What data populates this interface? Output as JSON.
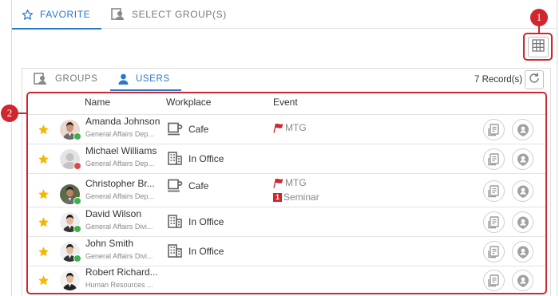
{
  "tabs": {
    "favorite": "FAVORITE",
    "select_groups": "SELECT GROUP(S)"
  },
  "sub_tabs": {
    "groups": "GROUPS",
    "users": "USERS"
  },
  "record_count": "7 Record(s)",
  "callouts": {
    "one": "1",
    "two": "2"
  },
  "columns": {
    "name": "Name",
    "workplace": "Workplace",
    "event": "Event"
  },
  "colors": {
    "accent": "#2b78c5",
    "callout": "#d0262d",
    "star": "#f5b800",
    "online": "#3cb34a",
    "busy": "#e04848"
  },
  "users": [
    {
      "name": "Amanda Johnson",
      "dept": "General Affairs Dep...",
      "status": "online",
      "workplace": "Cafe",
      "workplace_icon": "coffee-cup-icon",
      "events": [
        {
          "icon": "red-flag-icon",
          "label": "MTG"
        }
      ]
    },
    {
      "name": "Michael Williams",
      "dept": "General Affairs Dep...",
      "status": "busy",
      "workplace": "In Office",
      "workplace_icon": "office-building-icon",
      "events": []
    },
    {
      "name": "Christopher Br...",
      "dept": "General Affairs Dep...",
      "status": "online",
      "workplace": "Cafe",
      "workplace_icon": "coffee-cup-icon",
      "events": [
        {
          "icon": "red-flag-icon",
          "label": "MTG"
        },
        {
          "icon": "number-one-badge-icon",
          "badge": "1",
          "label": "Seminar"
        }
      ]
    },
    {
      "name": "David Wilson",
      "dept": "General Affairs Divi...",
      "status": "online",
      "workplace": "In Office",
      "workplace_icon": "office-building-icon",
      "events": []
    },
    {
      "name": "John Smith",
      "dept": "General Affairs Divi...",
      "status": "online",
      "workplace": "In Office",
      "workplace_icon": "office-building-icon",
      "events": []
    },
    {
      "name": "Robert Richard...",
      "dept": "Human Resources ...",
      "status": "none",
      "workplace": "",
      "workplace_icon": "",
      "events": []
    }
  ]
}
